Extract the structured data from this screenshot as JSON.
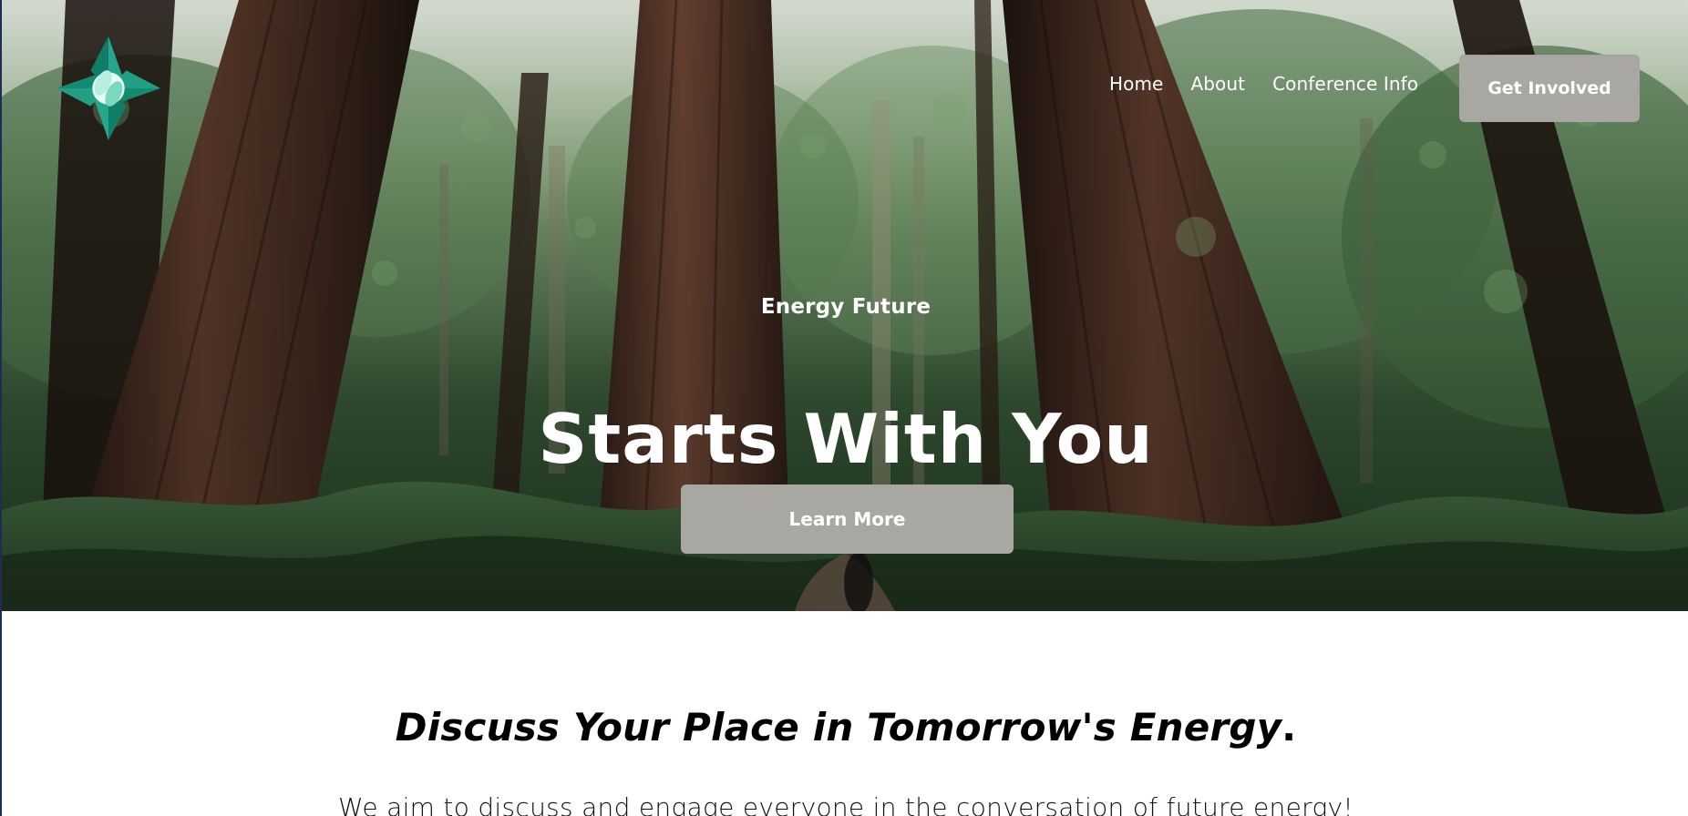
{
  "nav": {
    "items": [
      {
        "label": "Home"
      },
      {
        "label": "About"
      },
      {
        "label": "Conference Info"
      }
    ],
    "cta_label": "Get Involved"
  },
  "hero": {
    "eyebrow": "Energy Future",
    "title": "Starts With You",
    "button_label": "Learn More"
  },
  "section": {
    "heading": "Discuss Your Place in Tomorrow's Energy",
    "heading_suffix": ".",
    "subtitle": "We aim to discuss and engage everyone in the conversation of future energy!"
  },
  "icons": {
    "logo": "pinwheel-logo-icon"
  },
  "colors": {
    "button_bg": "#a8a7a1",
    "logo_green": "#1f9f7f",
    "logo_dark": "#0d6d5b",
    "forest_dark": "#1f341e",
    "forest_mid": "#355a34"
  }
}
